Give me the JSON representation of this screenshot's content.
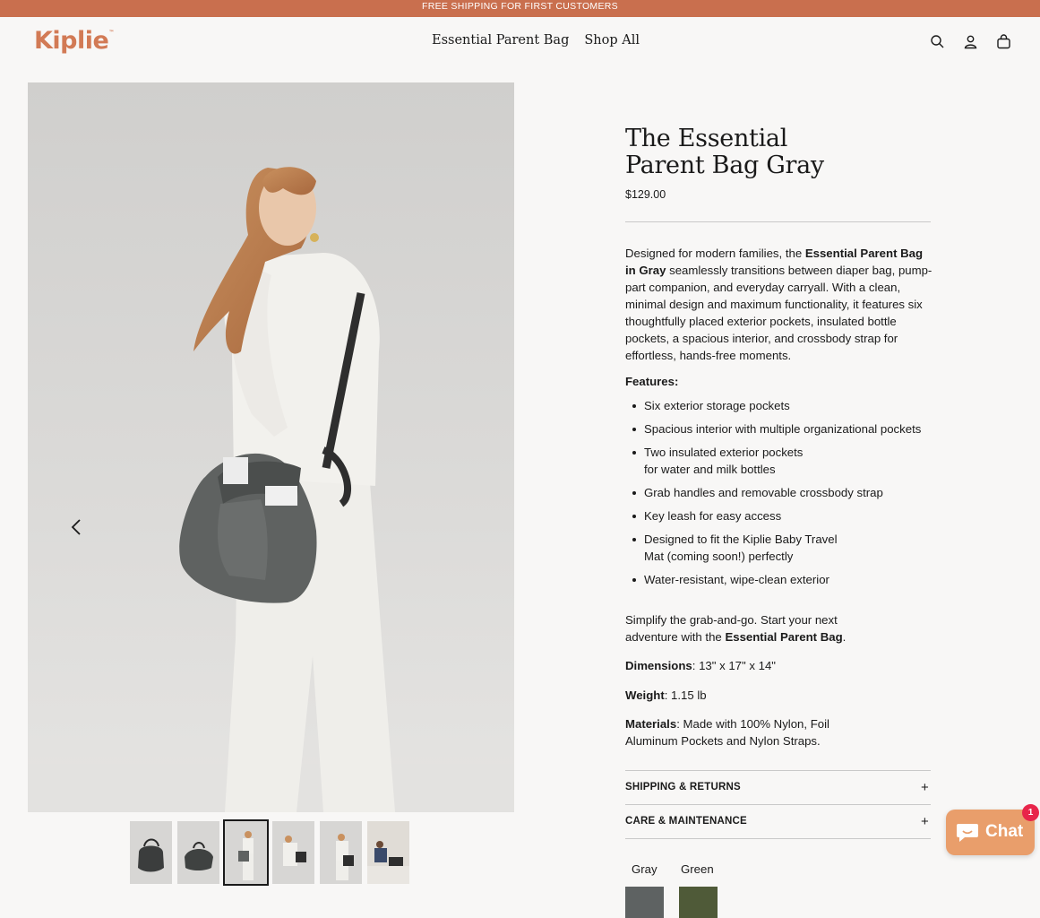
{
  "announcement": "FREE SHIPPING FOR FIRST CUSTOMERS",
  "brand": {
    "logo_text": "Kiplie",
    "trademark": "™",
    "color": "#d27a55"
  },
  "nav": {
    "items": [
      {
        "label": "Essential Parent Bag"
      },
      {
        "label": "Shop All"
      }
    ]
  },
  "header_icons": [
    "search-icon",
    "account-icon",
    "cart-icon"
  ],
  "gallery": {
    "thumbnail_count": 6,
    "active_index": 2
  },
  "product": {
    "title_line1": "The Essential",
    "title_line2": "Parent Bag Gray",
    "price": "$129.00",
    "description": {
      "p1": "Designed for modern families, the ",
      "bold": "Essential Parent Bag in Gray",
      "p2": " seamlessly transitions between diaper bag, pump-part companion, and everyday carryall. With a clean, minimal design and maximum functionality, it features six thoughtfully placed exterior pockets, insulated bottle pockets, a spacious interior, and crossbody strap for effortless, hands-free moments."
    },
    "features_heading": "Features:",
    "features": [
      "Six exterior storage pockets",
      "Spacious interior with multiple organizational pockets",
      "Two insulated exterior pockets for water and milk bottles",
      "Grab handles and removable crossbody strap",
      "Key leash for easy access",
      "Designed to fit the Kiplie Baby Travel Mat (coming soon!) perfectly",
      "Water-resistant, wipe-clean exterior"
    ],
    "simplify": {
      "pre": "Simplify the grab-and-go. Start your next adventure with the ",
      "bold": "Essential Parent Bag",
      "post": "."
    },
    "dimensions": {
      "label": "Dimensions",
      "value": ": 13\" x 17\" x 14\""
    },
    "weight": {
      "label": "Weight",
      "value": ": 1.15 lb"
    },
    "materials": {
      "label": "Materials",
      "value": ": Made with 100% Nylon, Foil Aluminum Pockets and Nylon Straps."
    },
    "accordions": [
      {
        "label": "SHIPPING & RETURNS"
      },
      {
        "label": "CARE & MAINTENANCE"
      }
    ],
    "accordion_icon": "+",
    "colors": [
      {
        "label": "Gray",
        "hex": "#5e6262"
      },
      {
        "label": "Green",
        "hex": "#4f5a38"
      }
    ]
  },
  "chat": {
    "label": "Chat",
    "badge": "1",
    "color": "#e99e6b"
  }
}
